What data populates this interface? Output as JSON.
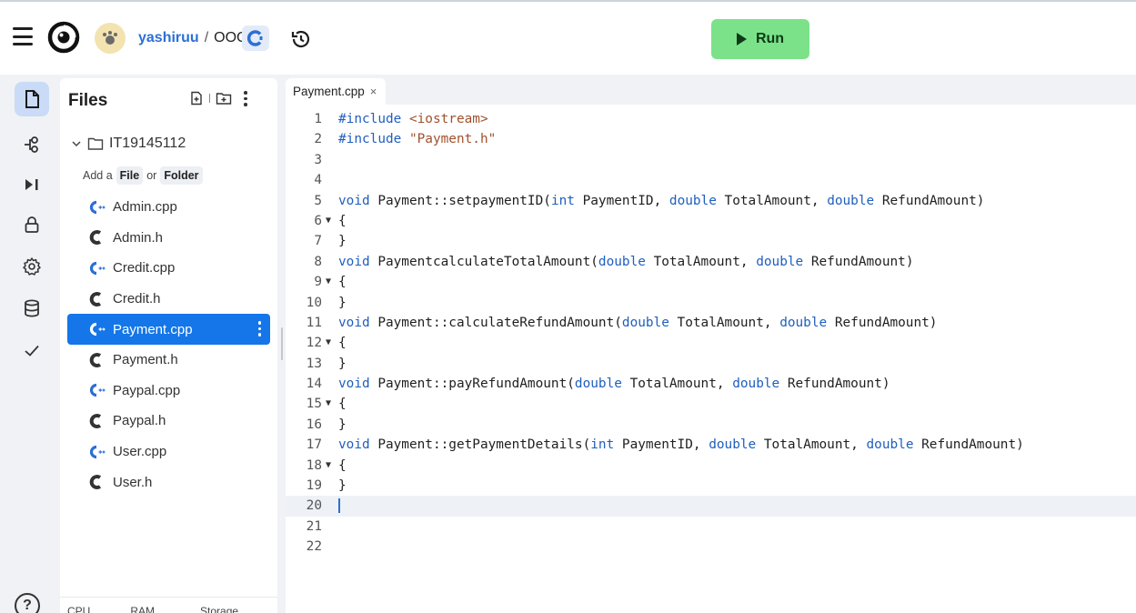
{
  "header": {
    "user": "yashiruu",
    "separator": "/",
    "repl_name": "OOC",
    "lang_badge": "C",
    "run_label": "Run"
  },
  "rail": {
    "icons": [
      "file-icon",
      "git-icon",
      "console-icon",
      "lock-icon",
      "gear-icon",
      "database-icon",
      "check-icon"
    ],
    "help": "?"
  },
  "files": {
    "title": "Files",
    "root_folder": "IT19145112",
    "add_prefix": "Add a",
    "add_file": "File",
    "add_or": "or",
    "add_folder": "Folder",
    "items": [
      {
        "name": "Admin.cpp",
        "type": "cpp"
      },
      {
        "name": "Admin.h",
        "type": "h"
      },
      {
        "name": "Credit.cpp",
        "type": "cpp"
      },
      {
        "name": "Credit.h",
        "type": "h"
      },
      {
        "name": "Payment.cpp",
        "type": "cpp",
        "selected": true
      },
      {
        "name": "Payment.h",
        "type": "h"
      },
      {
        "name": "Paypal.cpp",
        "type": "cpp"
      },
      {
        "name": "Paypal.h",
        "type": "h"
      },
      {
        "name": "User.cpp",
        "type": "cpp"
      },
      {
        "name": "User.h",
        "type": "h"
      }
    ],
    "resources": [
      "CPU",
      "RAM",
      "Storage"
    ]
  },
  "editor": {
    "tab_label": "Payment.cpp",
    "tab_close": "×",
    "active_line": 20,
    "lines": [
      {
        "n": "1",
        "fold": "",
        "code": [
          [
            "pp",
            "#include "
          ],
          [
            "inc",
            "<iostream>"
          ]
        ]
      },
      {
        "n": "2",
        "fold": "",
        "code": [
          [
            "pp",
            "#include "
          ],
          [
            "str",
            "\"Payment.h\""
          ]
        ]
      },
      {
        "n": "3",
        "fold": "",
        "code": []
      },
      {
        "n": "4",
        "fold": "",
        "code": []
      },
      {
        "n": "5",
        "fold": "",
        "code": [
          [
            "kw",
            "void"
          ],
          [
            "",
            " Payment::setpaymentID("
          ],
          [
            "kw",
            "int"
          ],
          [
            "",
            " PaymentID, "
          ],
          [
            "kw",
            "double"
          ],
          [
            "",
            " TotalAmount, "
          ],
          [
            "kw",
            "double"
          ],
          [
            "",
            " RefundAmount)"
          ]
        ]
      },
      {
        "n": "6",
        "fold": "▼",
        "code": [
          [
            "",
            "{"
          ]
        ]
      },
      {
        "n": "7",
        "fold": "",
        "code": [
          [
            "",
            "}"
          ]
        ]
      },
      {
        "n": "8",
        "fold": "",
        "code": [
          [
            "kw",
            "void"
          ],
          [
            "",
            " PaymentcalculateTotalAmount("
          ],
          [
            "kw",
            "double"
          ],
          [
            "",
            " TotalAmount, "
          ],
          [
            "kw",
            "double"
          ],
          [
            "",
            " RefundAmount)"
          ]
        ]
      },
      {
        "n": "9",
        "fold": "▼",
        "code": [
          [
            "",
            "{"
          ]
        ]
      },
      {
        "n": "10",
        "fold": "",
        "code": [
          [
            "",
            "}"
          ]
        ]
      },
      {
        "n": "11",
        "fold": "",
        "code": [
          [
            "kw",
            "void"
          ],
          [
            "",
            " Payment::calculateRefundAmount("
          ],
          [
            "kw",
            "double"
          ],
          [
            "",
            " TotalAmount, "
          ],
          [
            "kw",
            "double"
          ],
          [
            "",
            " RefundAmount)"
          ]
        ]
      },
      {
        "n": "12",
        "fold": "▼",
        "code": [
          [
            "",
            "{"
          ]
        ]
      },
      {
        "n": "13",
        "fold": "",
        "code": [
          [
            "",
            "}"
          ]
        ]
      },
      {
        "n": "14",
        "fold": "",
        "code": [
          [
            "kw",
            "void"
          ],
          [
            "",
            " Payment::payRefundAmount("
          ],
          [
            "kw",
            "double"
          ],
          [
            "",
            " TotalAmount, "
          ],
          [
            "kw",
            "double"
          ],
          [
            "",
            " RefundAmount)"
          ]
        ]
      },
      {
        "n": "15",
        "fold": "▼",
        "code": [
          [
            "",
            "{"
          ]
        ]
      },
      {
        "n": "16",
        "fold": "",
        "code": [
          [
            "",
            "}"
          ]
        ]
      },
      {
        "n": "17",
        "fold": "",
        "code": [
          [
            "kw",
            "void"
          ],
          [
            "",
            " Payment::getPaymentDetails("
          ],
          [
            "kw",
            "int"
          ],
          [
            "",
            " PaymentID, "
          ],
          [
            "kw",
            "double"
          ],
          [
            "",
            " TotalAmount, "
          ],
          [
            "kw",
            "double"
          ],
          [
            "",
            " RefundAmount)"
          ]
        ]
      },
      {
        "n": "18",
        "fold": "▼",
        "code": [
          [
            "",
            "{"
          ]
        ]
      },
      {
        "n": "19",
        "fold": "",
        "code": [
          [
            "",
            "}"
          ]
        ]
      },
      {
        "n": "20",
        "fold": "",
        "code": []
      },
      {
        "n": "21",
        "fold": "",
        "code": []
      },
      {
        "n": "22",
        "fold": "",
        "code": []
      }
    ]
  },
  "colors": {
    "accent": "#1476e8",
    "run_green": "#7ce28a",
    "keyword": "#1f5fbf",
    "string": "#a0522d"
  }
}
